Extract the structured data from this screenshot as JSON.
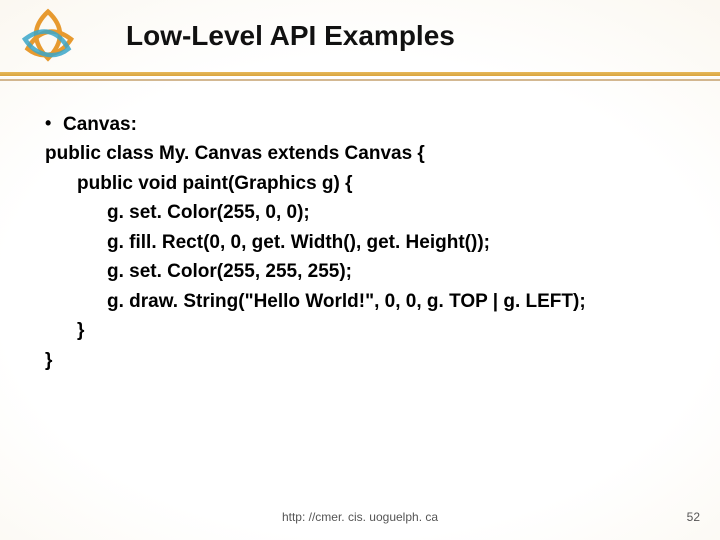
{
  "header": {
    "title": "Low-Level API Examples",
    "logo_name": "triquetra-logo"
  },
  "body": {
    "bullet_label": "Canvas:",
    "lines": {
      "l1": "public class My. Canvas extends Canvas {",
      "l2": "public void paint(Graphics g) {",
      "l3": "g. set. Color(255, 0, 0);",
      "l4": "g. fill. Rect(0, 0, get. Width(), get. Height());",
      "l5": "g. set. Color(255, 255, 255);",
      "l6": "g. draw. String(\"Hello World!\", 0, 0, g. TOP | g. LEFT);",
      "l7": "}",
      "l8": "}"
    }
  },
  "footer": {
    "url": "http: //cmer. cis. uoguelph. ca",
    "page": "52"
  },
  "colors": {
    "accent": "#e79a2f",
    "accent2": "#3aa6c9"
  }
}
